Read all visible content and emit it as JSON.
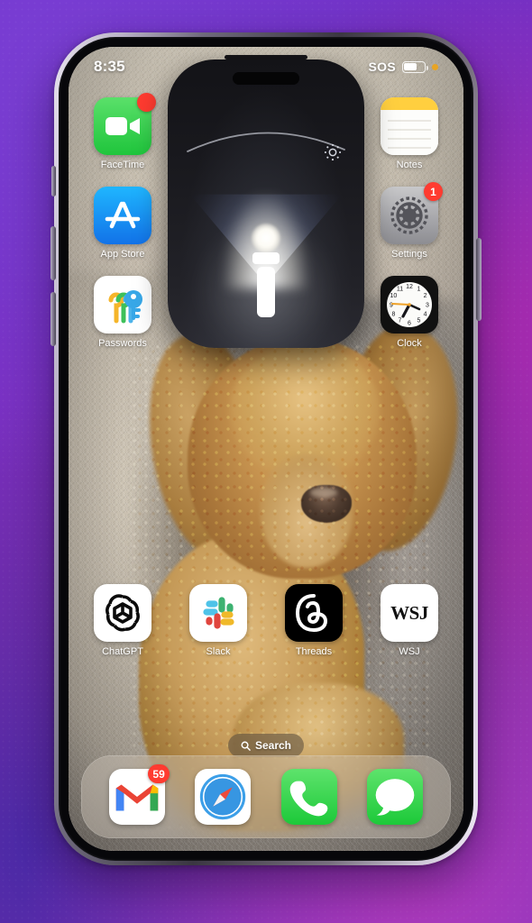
{
  "status_bar": {
    "time": "8:35",
    "sos_label": "SOS",
    "battery_level_percent": 62
  },
  "flashlight_overlay": {
    "name": "Flashlight",
    "state": "on",
    "brightness_icon": "brightness-sun-icon",
    "beam_icon": "flashlight-beam-icon",
    "arc_icon": "beam-width-arc"
  },
  "home_screen": {
    "rows": [
      {
        "left": {
          "app": "FaceTime",
          "icon": "facetime-icon",
          "badge": ""
        },
        "right": {
          "app": "Notes",
          "icon": "notes-icon",
          "badge": ""
        }
      },
      {
        "left": {
          "app": "App Store",
          "icon": "app-store-icon",
          "badge": ""
        },
        "right": {
          "app": "Settings",
          "icon": "settings-icon",
          "badge": "1"
        }
      },
      {
        "left": {
          "app": "Passwords",
          "icon": "passwords-icon",
          "badge": ""
        },
        "right": {
          "app": "Clock",
          "icon": "clock-icon",
          "badge": ""
        }
      }
    ],
    "bottom_row": [
      {
        "app": "ChatGPT",
        "icon": "chatgpt-icon",
        "badge": ""
      },
      {
        "app": "Slack",
        "icon": "slack-icon",
        "badge": ""
      },
      {
        "app": "Threads",
        "icon": "threads-icon",
        "badge": ""
      },
      {
        "app": "WSJ",
        "icon": "wsj-icon",
        "badge": "",
        "wordmark": "WSJ"
      }
    ]
  },
  "search": {
    "label": "Search",
    "icon": "search-icon"
  },
  "dock": {
    "items": [
      {
        "app": "Gmail",
        "icon": "gmail-icon",
        "badge": "59"
      },
      {
        "app": "Safari",
        "icon": "safari-icon",
        "badge": ""
      },
      {
        "app": "Phone",
        "icon": "phone-icon",
        "badge": ""
      },
      {
        "app": "Messages",
        "icon": "messages-icon",
        "badge": ""
      }
    ]
  },
  "wallpaper": {
    "subject": "sleeping apricot curly-haired dog on a sofa"
  },
  "colors": {
    "backdrop_purple": "#6a31c9",
    "backdrop_magenta": "#92309f",
    "badge_red": "#ff3b30",
    "facetime_green": "#1fc53c",
    "appstore_blue": "#1272e8",
    "overlay_black": "#131317"
  },
  "device": {
    "side_buttons": [
      "action-button",
      "volume-up-button",
      "volume-down-button",
      "power-button"
    ]
  }
}
